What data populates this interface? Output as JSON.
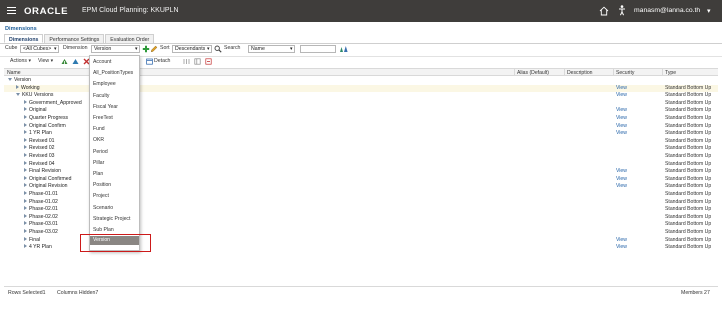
{
  "header": {
    "logo": "ORACLE",
    "app_title": "EPM Cloud Planning:  KKUPLN",
    "user": "manasm@lanna.co.th",
    "user_chevron": "▾"
  },
  "page_title": "Dimensions",
  "tabs": [
    {
      "label": "Dimensions"
    },
    {
      "label": "Performance Settings"
    },
    {
      "label": "Evaluation Order"
    }
  ],
  "filters": {
    "cube_label": "Cube",
    "cube_value": "<All Cubes>",
    "dimension_label": "Dimension",
    "dimension_value": "Version",
    "sort_label": "Sort",
    "sort_value": "Descendants",
    "search_label": "Search",
    "search_field_value": "Name",
    "search_text": ""
  },
  "toolbar": {
    "actions_label": "Actions",
    "view_label": "View",
    "detach_label": "Detach"
  },
  "columns": {
    "name": "Name",
    "alias": "Alias (Default)",
    "description": "Description",
    "security": "Security",
    "type": "Type"
  },
  "rows": [
    {
      "name": "Version",
      "indent": 0,
      "tri": "open",
      "security": "",
      "type": ""
    },
    {
      "name": "Working",
      "indent": 1,
      "tri": "closed",
      "security": "View",
      "type": "Standard Bottom Up",
      "hl": true
    },
    {
      "name": "KKU Versions",
      "indent": 1,
      "tri": "open",
      "security": "View",
      "type": "Standard Bottom Up"
    },
    {
      "name": "Government_Approved",
      "indent": 2,
      "tri": "closed",
      "security": "",
      "type": "Standard Bottom Up"
    },
    {
      "name": "Original",
      "indent": 2,
      "tri": "closed",
      "security": "View",
      "type": "Standard Bottom Up"
    },
    {
      "name": "Quarter Progress",
      "indent": 2,
      "tri": "closed",
      "security": "View",
      "type": "Standard Bottom Up"
    },
    {
      "name": "Original Confirm",
      "indent": 2,
      "tri": "closed",
      "security": "View",
      "type": "Standard Bottom Up"
    },
    {
      "name": "1 YR Plan",
      "indent": 2,
      "tri": "closed",
      "security": "View",
      "type": "Standard Bottom Up"
    },
    {
      "name": "Revised 01",
      "indent": 2,
      "tri": "closed",
      "security": "",
      "type": "Standard Bottom Up"
    },
    {
      "name": "Revised 02",
      "indent": 2,
      "tri": "closed",
      "security": "",
      "type": "Standard Bottom Up"
    },
    {
      "name": "Revised 03",
      "indent": 2,
      "tri": "closed",
      "security": "",
      "type": "Standard Bottom Up"
    },
    {
      "name": "Revised 04",
      "indent": 2,
      "tri": "closed",
      "security": "",
      "type": "Standard Bottom Up"
    },
    {
      "name": "Final Revision",
      "indent": 2,
      "tri": "closed",
      "security": "View",
      "type": "Standard Bottom Up"
    },
    {
      "name": "Original Confirmed",
      "indent": 2,
      "tri": "closed",
      "security": "View",
      "type": "Standard Bottom Up"
    },
    {
      "name": "Original Revision",
      "indent": 2,
      "tri": "closed",
      "security": "View",
      "type": "Standard Bottom Up"
    },
    {
      "name": "Phase-01.01",
      "indent": 2,
      "tri": "closed",
      "security": "",
      "type": "Standard Bottom Up"
    },
    {
      "name": "Phase-01.02",
      "indent": 2,
      "tri": "closed",
      "security": "",
      "type": "Standard Bottom Up"
    },
    {
      "name": "Phase-02.01",
      "indent": 2,
      "tri": "closed",
      "security": "",
      "type": "Standard Bottom Up"
    },
    {
      "name": "Phase-02.02",
      "indent": 2,
      "tri": "closed",
      "security": "",
      "type": "Standard Bottom Up"
    },
    {
      "name": "Phase-03.01",
      "indent": 2,
      "tri": "closed",
      "security": "",
      "type": "Standard Bottom Up"
    },
    {
      "name": "Phase-03.02",
      "indent": 2,
      "tri": "closed",
      "security": "",
      "type": "Standard Bottom Up"
    },
    {
      "name": "Final",
      "indent": 2,
      "tri": "closed",
      "security": "View",
      "type": "Standard Bottom Up"
    },
    {
      "name": "4 YR Plan",
      "indent": 2,
      "tri": "closed",
      "security": "View",
      "type": "Standard Bottom Up"
    }
  ],
  "dropdown": {
    "options": [
      "Account",
      "All_PositionTypes",
      "Employee",
      "Faculty",
      "Fiscal Year",
      "FreeText",
      "Fund",
      "OKR",
      "Period",
      "Pillar",
      "Plan",
      "Position",
      "Project",
      "Scenario",
      "Strategic Project",
      "Sub Plan",
      "Version"
    ],
    "selected_index": 16
  },
  "footer": {
    "rows_selected": "Rows Selected1",
    "columns_hidden": "Columns Hidden7",
    "members": "Members 27"
  },
  "colors": {
    "topbar": "#3f3d3b",
    "link": "#1f5fa6",
    "highlight_row": "#fbf7e4",
    "dropdown_selected": "#8a8683",
    "annotation_box": "#cc1a1a"
  }
}
